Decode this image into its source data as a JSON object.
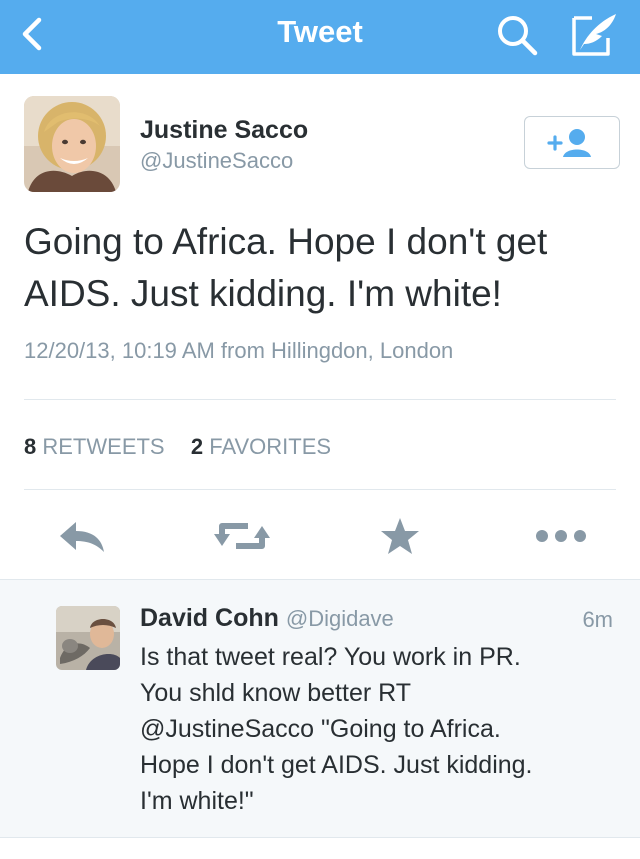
{
  "navbar": {
    "title": "Tweet",
    "back_icon": "chevron-left-icon",
    "search_icon": "search-icon",
    "compose_icon": "compose-quill-icon",
    "background_color": "#55acee"
  },
  "tweet": {
    "author": {
      "name": "Justine Sacco",
      "handle": "@JustineSacco",
      "avatar_icon": "profile-photo"
    },
    "follow_icon": "add-user-icon",
    "text": "Going to Africa. Hope I don't get AIDS. Just kidding. I'm white!",
    "meta": "12/20/13, 10:19 AM from Hillingdon, London",
    "stats": {
      "retweets_count": "8",
      "retweets_label": "RETWEETS",
      "favorites_count": "2",
      "favorites_label": "FAVORITES"
    },
    "actions": [
      {
        "name": "reply",
        "icon": "reply-icon"
      },
      {
        "name": "retweet",
        "icon": "retweet-icon"
      },
      {
        "name": "favorite",
        "icon": "star-icon"
      },
      {
        "name": "more",
        "icon": "more-dots-icon"
      }
    ]
  },
  "reply": {
    "author_name": "David Cohn",
    "handle": "@Digidave",
    "time": "6m",
    "lines": [
      "Is that tweet real? You work in PR.",
      "You shld know better RT",
      "@JustineSacco \"Going to Africa.",
      "Hope I don't get AIDS. Just kidding.",
      "I'm white!\""
    ],
    "avatar_icon": "profile-photo"
  },
  "colors": {
    "accent": "#55acee",
    "text": "#292f33",
    "muted": "#8899a6",
    "icon_gray": "#8899a6",
    "divider": "#e1e8ed",
    "reply_background": "#f5f8fa"
  }
}
